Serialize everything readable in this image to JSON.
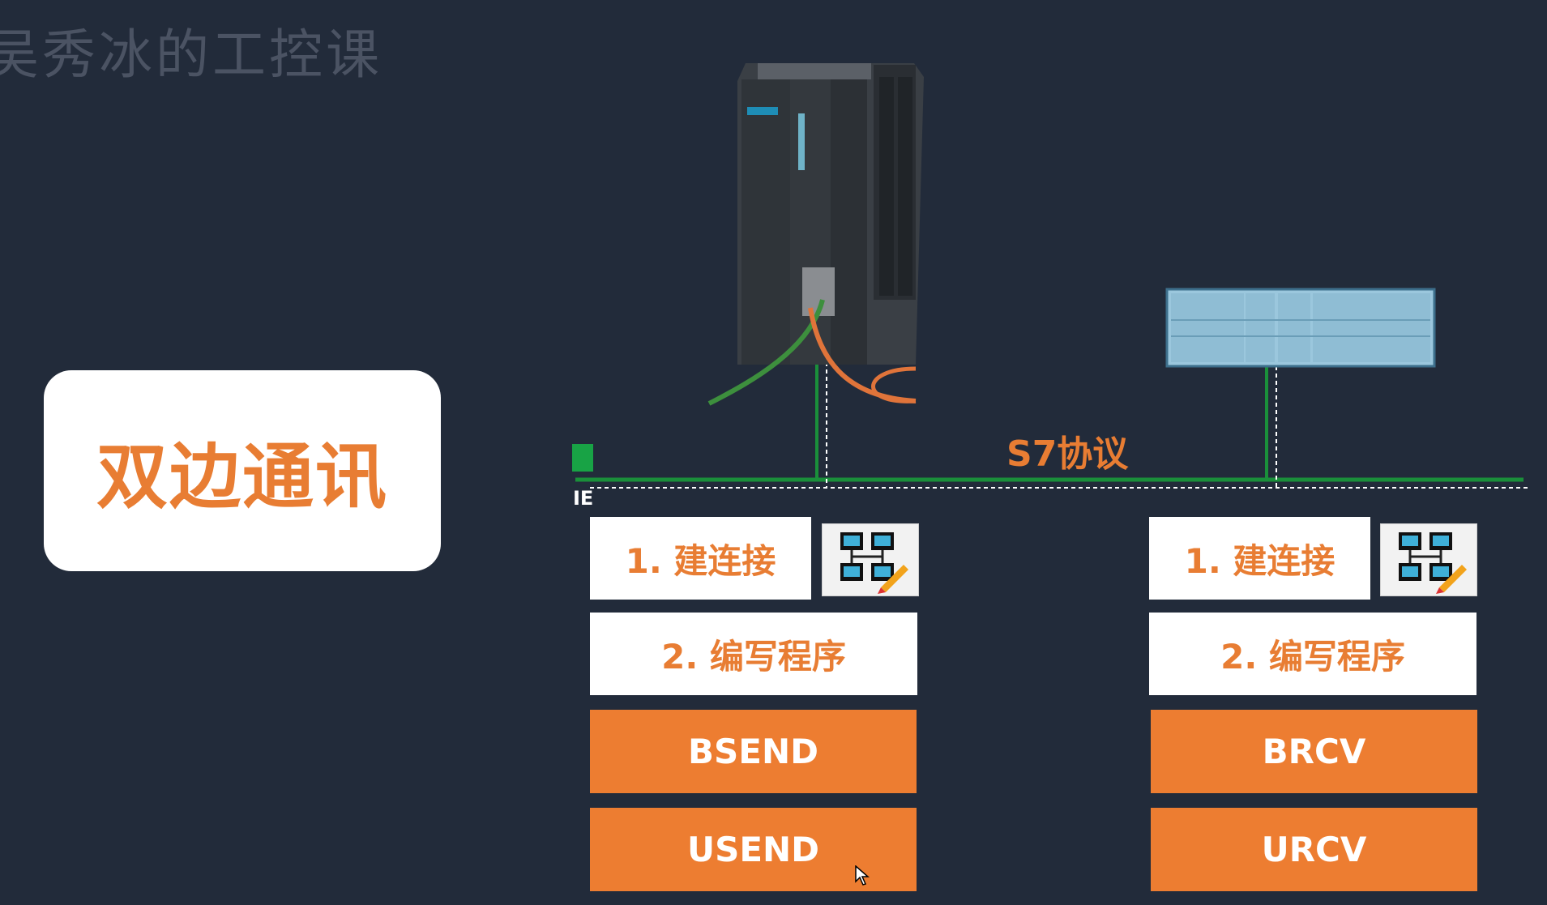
{
  "watermark": "吴秀冰的工控课",
  "title_card": {
    "text": "双边通讯"
  },
  "network": {
    "protocol_label": "S7协议",
    "ie_label": "IE"
  },
  "left_station": {
    "step1": "1. 建连接",
    "step2": "2. 编写程序",
    "block1": "BSEND",
    "block2": "USEND",
    "icon": "network-config-icon"
  },
  "right_station": {
    "step1": "1. 建连接",
    "step2": "2. 编写程序",
    "block1": "BRCV",
    "block2": "URCV",
    "icon": "network-config-icon"
  },
  "colors": {
    "background": "#222b3a",
    "accent": "#ed7d31",
    "network": "#1a8f3a"
  }
}
